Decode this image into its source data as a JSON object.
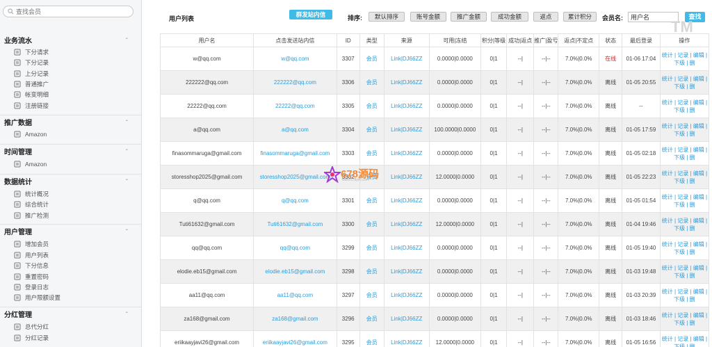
{
  "sidebar": {
    "search_placeholder": "查找会员",
    "sections": [
      {
        "title": "业务流水",
        "items": [
          "下分请求",
          "下分记录",
          "上分记录",
          "普通推广",
          "帐变明细",
          "注册链接"
        ]
      },
      {
        "title": "推广数据",
        "items": [
          "Amazon"
        ]
      },
      {
        "title": "时间管理",
        "items": [
          "Amazon"
        ]
      },
      {
        "title": "数据统计",
        "items": [
          "统计概况",
          "综合统计",
          "推广检测"
        ]
      },
      {
        "title": "用户管理",
        "items": [
          "增加会员",
          "用户列表",
          "下分信息",
          "重置密码",
          "登录日志",
          "用户限额设置"
        ]
      },
      {
        "title": "分红管理",
        "items": [
          "总代分红",
          "分红记录"
        ]
      }
    ]
  },
  "toolbar": {
    "title": "用户列表",
    "broadcast_label": "群发站内信",
    "sort_label": "排序:",
    "sort_buttons": [
      "默认排序",
      "账号金额",
      "推广金额",
      "成功金额",
      "返点",
      "累计积分"
    ],
    "member_label": "会员名:",
    "member_value": "用户名",
    "find_label": "查找"
  },
  "watermark": {
    "tm": "TM",
    "logo_text": "678源码",
    "logo_url": "www.678ym.com"
  },
  "colors": {
    "accent": "#3fbbe8",
    "link": "#2b9bd8",
    "online": "#e02020",
    "logo": "#f08a3a"
  },
  "table": {
    "headers": [
      "用户名",
      "点击发送站内信",
      "ID",
      "类型",
      "来源",
      "可用|冻结",
      "积分|等级",
      "成功|返点",
      "推广|盈亏",
      "返点|不定点",
      "状态",
      "最后登录",
      "操作"
    ],
    "rows": [
      {
        "name": "w@qq.com",
        "msg": "w@qq.com",
        "id": "3307",
        "type": "会员",
        "source": "Link|DJ66ZZ",
        "balance": "0.0000|0.0000",
        "points": "0|1",
        "success": "--|",
        "promo": "--|--",
        "rebate": "7.0%|0.0%",
        "status": "在线",
        "online": true,
        "last": "01-06 17:04",
        "ops": "统计 | 记录 | 编辑 | 下级 | 删"
      },
      {
        "name": "222222@qq.com",
        "msg": "222222@qq.com",
        "id": "3306",
        "type": "会员",
        "source": "Link|DJ66ZZ",
        "balance": "0.0000|0.0000",
        "points": "0|1",
        "success": "--|",
        "promo": "--|--",
        "rebate": "7.0%|0.0%",
        "status": "离线",
        "online": false,
        "last": "01-05 20:55",
        "ops": "统计 | 记录 | 编辑 | 下级 | 删"
      },
      {
        "name": "22222@qq.com",
        "msg": "22222@qq.com",
        "id": "3305",
        "type": "会员",
        "source": "Link|DJ66ZZ",
        "balance": "0.0000|0.0000",
        "points": "0|1",
        "success": "--|",
        "promo": "--|--",
        "rebate": "7.0%|0.0%",
        "status": "离线",
        "online": false,
        "last": "--",
        "ops": "统计 | 记录 | 编辑 | 下级 | 删"
      },
      {
        "name": "a@qq.com",
        "msg": "a@qq.com",
        "id": "3304",
        "type": "会员",
        "source": "Link|DJ66ZZ",
        "balance": "100.0000|0.0000",
        "points": "0|1",
        "success": "--|",
        "promo": "--|--",
        "rebate": "7.0%|0.0%",
        "status": "离线",
        "online": false,
        "last": "01-05 17:59",
        "ops": "统计 | 记录 | 编辑 | 下级 | 删"
      },
      {
        "name": "finasommaruga@gmail.com",
        "msg": "finasommaruga@gmail.com",
        "id": "3303",
        "type": "会员",
        "source": "Link|DJ66ZZ",
        "balance": "0.0000|0.0000",
        "points": "0|1",
        "success": "--|",
        "promo": "--|--",
        "rebate": "7.0%|0.0%",
        "status": "离线",
        "online": false,
        "last": "01-05 02:18",
        "ops": "统计 | 记录 | 编辑 | 下级 | 删"
      },
      {
        "name": "storesshop2025@gmail.com",
        "msg": "storesshop2025@gmail.com",
        "id": "3302",
        "type": "会员",
        "source": "Link|DJ66ZZ",
        "balance": "12.0000|0.0000",
        "points": "0|1",
        "success": "--|",
        "promo": "--|--",
        "rebate": "7.0%|0.0%",
        "status": "离线",
        "online": false,
        "last": "01-05 22:23",
        "ops": "统计 | 记录 | 编辑 | 下级 | 删"
      },
      {
        "name": "q@qq.com",
        "msg": "q@qq.com",
        "id": "3301",
        "type": "会员",
        "source": "Link|DJ66ZZ",
        "balance": "0.0000|0.0000",
        "points": "0|1",
        "success": "--|",
        "promo": "--|--",
        "rebate": "7.0%|0.0%",
        "status": "离线",
        "online": false,
        "last": "01-05 01:54",
        "ops": "统计 | 记录 | 编辑 | 下级 | 删"
      },
      {
        "name": "Tuti61632@gmail.com",
        "msg": "Tuti61632@gmail.com",
        "id": "3300",
        "type": "会员",
        "source": "Link|DJ66ZZ",
        "balance": "12.0000|0.0000",
        "points": "0|1",
        "success": "--|",
        "promo": "--|--",
        "rebate": "7.0%|0.0%",
        "status": "离线",
        "online": false,
        "last": "01-04 19:46",
        "ops": "统计 | 记录 | 编辑 | 下级 | 删"
      },
      {
        "name": "qq@qq.com",
        "msg": "qq@qq.com",
        "id": "3299",
        "type": "会员",
        "source": "Link|DJ66ZZ",
        "balance": "0.0000|0.0000",
        "points": "0|1",
        "success": "--|",
        "promo": "--|--",
        "rebate": "7.0%|0.0%",
        "status": "离线",
        "online": false,
        "last": "01-05 19:40",
        "ops": "统计 | 记录 | 编辑 | 下级 | 删"
      },
      {
        "name": "elodie.eb15@gmail.com",
        "msg": "elodie.eb15@gmail.com",
        "id": "3298",
        "type": "会员",
        "source": "Link|DJ66ZZ",
        "balance": "0.0000|0.0000",
        "points": "0|1",
        "success": "--|",
        "promo": "--|--",
        "rebate": "7.0%|0.0%",
        "status": "离线",
        "online": false,
        "last": "01-03 19:48",
        "ops": "统计 | 记录 | 编辑 | 下级 | 删"
      },
      {
        "name": "aa11@qq.com",
        "msg": "aa11@qq.com",
        "id": "3297",
        "type": "会员",
        "source": "Link|DJ66ZZ",
        "balance": "0.0000|0.0000",
        "points": "0|1",
        "success": "--|",
        "promo": "--|--",
        "rebate": "7.0%|0.0%",
        "status": "离线",
        "online": false,
        "last": "01-03 20:39",
        "ops": "统计 | 记录 | 编辑 | 下级 | 删"
      },
      {
        "name": "za168@gmail.com",
        "msg": "za168@gmail.com",
        "id": "3296",
        "type": "会员",
        "source": "Link|DJ66ZZ",
        "balance": "0.0000|0.0000",
        "points": "0|1",
        "success": "--|",
        "promo": "--|--",
        "rebate": "7.0%|0.0%",
        "status": "离线",
        "online": false,
        "last": "01-03 18:46",
        "ops": "统计 | 记录 | 编辑 | 下级 | 删"
      },
      {
        "name": "eriikaayjavi26@gmail.com",
        "msg": "eriikaayjavi26@gmail.com",
        "id": "3295",
        "type": "会员",
        "source": "Link|DJ66ZZ",
        "balance": "12.0000|0.0000",
        "points": "0|1",
        "success": "--|",
        "promo": "--|--",
        "rebate": "7.0%|0.0%",
        "status": "离线",
        "online": false,
        "last": "01-05 16:56",
        "ops": "统计 | 记录 | 编辑 | 下级 | 删"
      }
    ]
  }
}
